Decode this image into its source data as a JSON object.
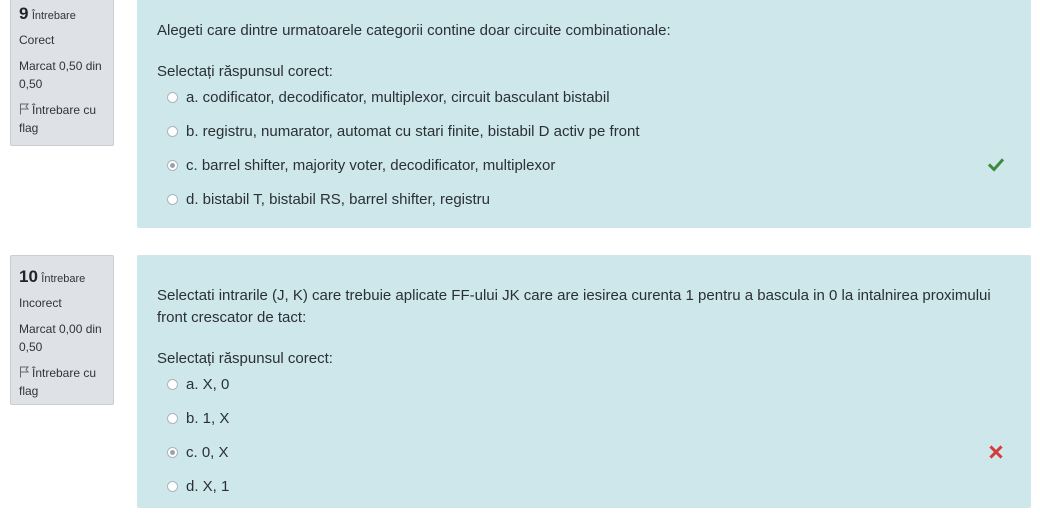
{
  "questions": [
    {
      "number": "9",
      "number_word": "Întrebare",
      "state": "Corect",
      "grade": "Marcat 0,50 din 0,50",
      "flag_label": "Întrebare cu flag",
      "text": "Alegeti care dintre urmatoarele categorii contine doar circuite combinationale:",
      "prompt": "Selectați răspunsul corect:",
      "answers": [
        "a. codificator, decodificator, multiplexor, circuit basculant bistabil",
        "b. registru, numarator, automat cu stari finite, bistabil D activ pe front",
        "c. barrel shifter, majority voter, decodificator, multiplexor",
        "d. bistabil T, bistabil RS, barrel shifter, registru"
      ],
      "selected": 2,
      "feedback": "correct",
      "feedback_icon": "check-icon",
      "feedback_color": "#3c8a3c"
    },
    {
      "number": "10",
      "number_word": "Întrebare",
      "state": "Incorect",
      "grade": "Marcat 0,00 din 0,50",
      "flag_label": "Întrebare cu flag",
      "text": "Selectati intrarile (J, K) care trebuie aplicate FF-ului JK care are iesirea curenta 1 pentru a bascula in 0 la intalnirea proximului front crescator de tact:",
      "prompt": "Selectați răspunsul corect:",
      "answers": [
        "a. X, 0",
        "b. 1, X",
        "c. 0, X",
        "d. X, 1"
      ],
      "selected": 2,
      "feedback": "incorrect",
      "feedback_icon": "cross-icon",
      "feedback_color": "#d73a3a"
    }
  ],
  "colors": {
    "info_bg": "#dee2e6",
    "content_bg": "#cde7ea"
  }
}
